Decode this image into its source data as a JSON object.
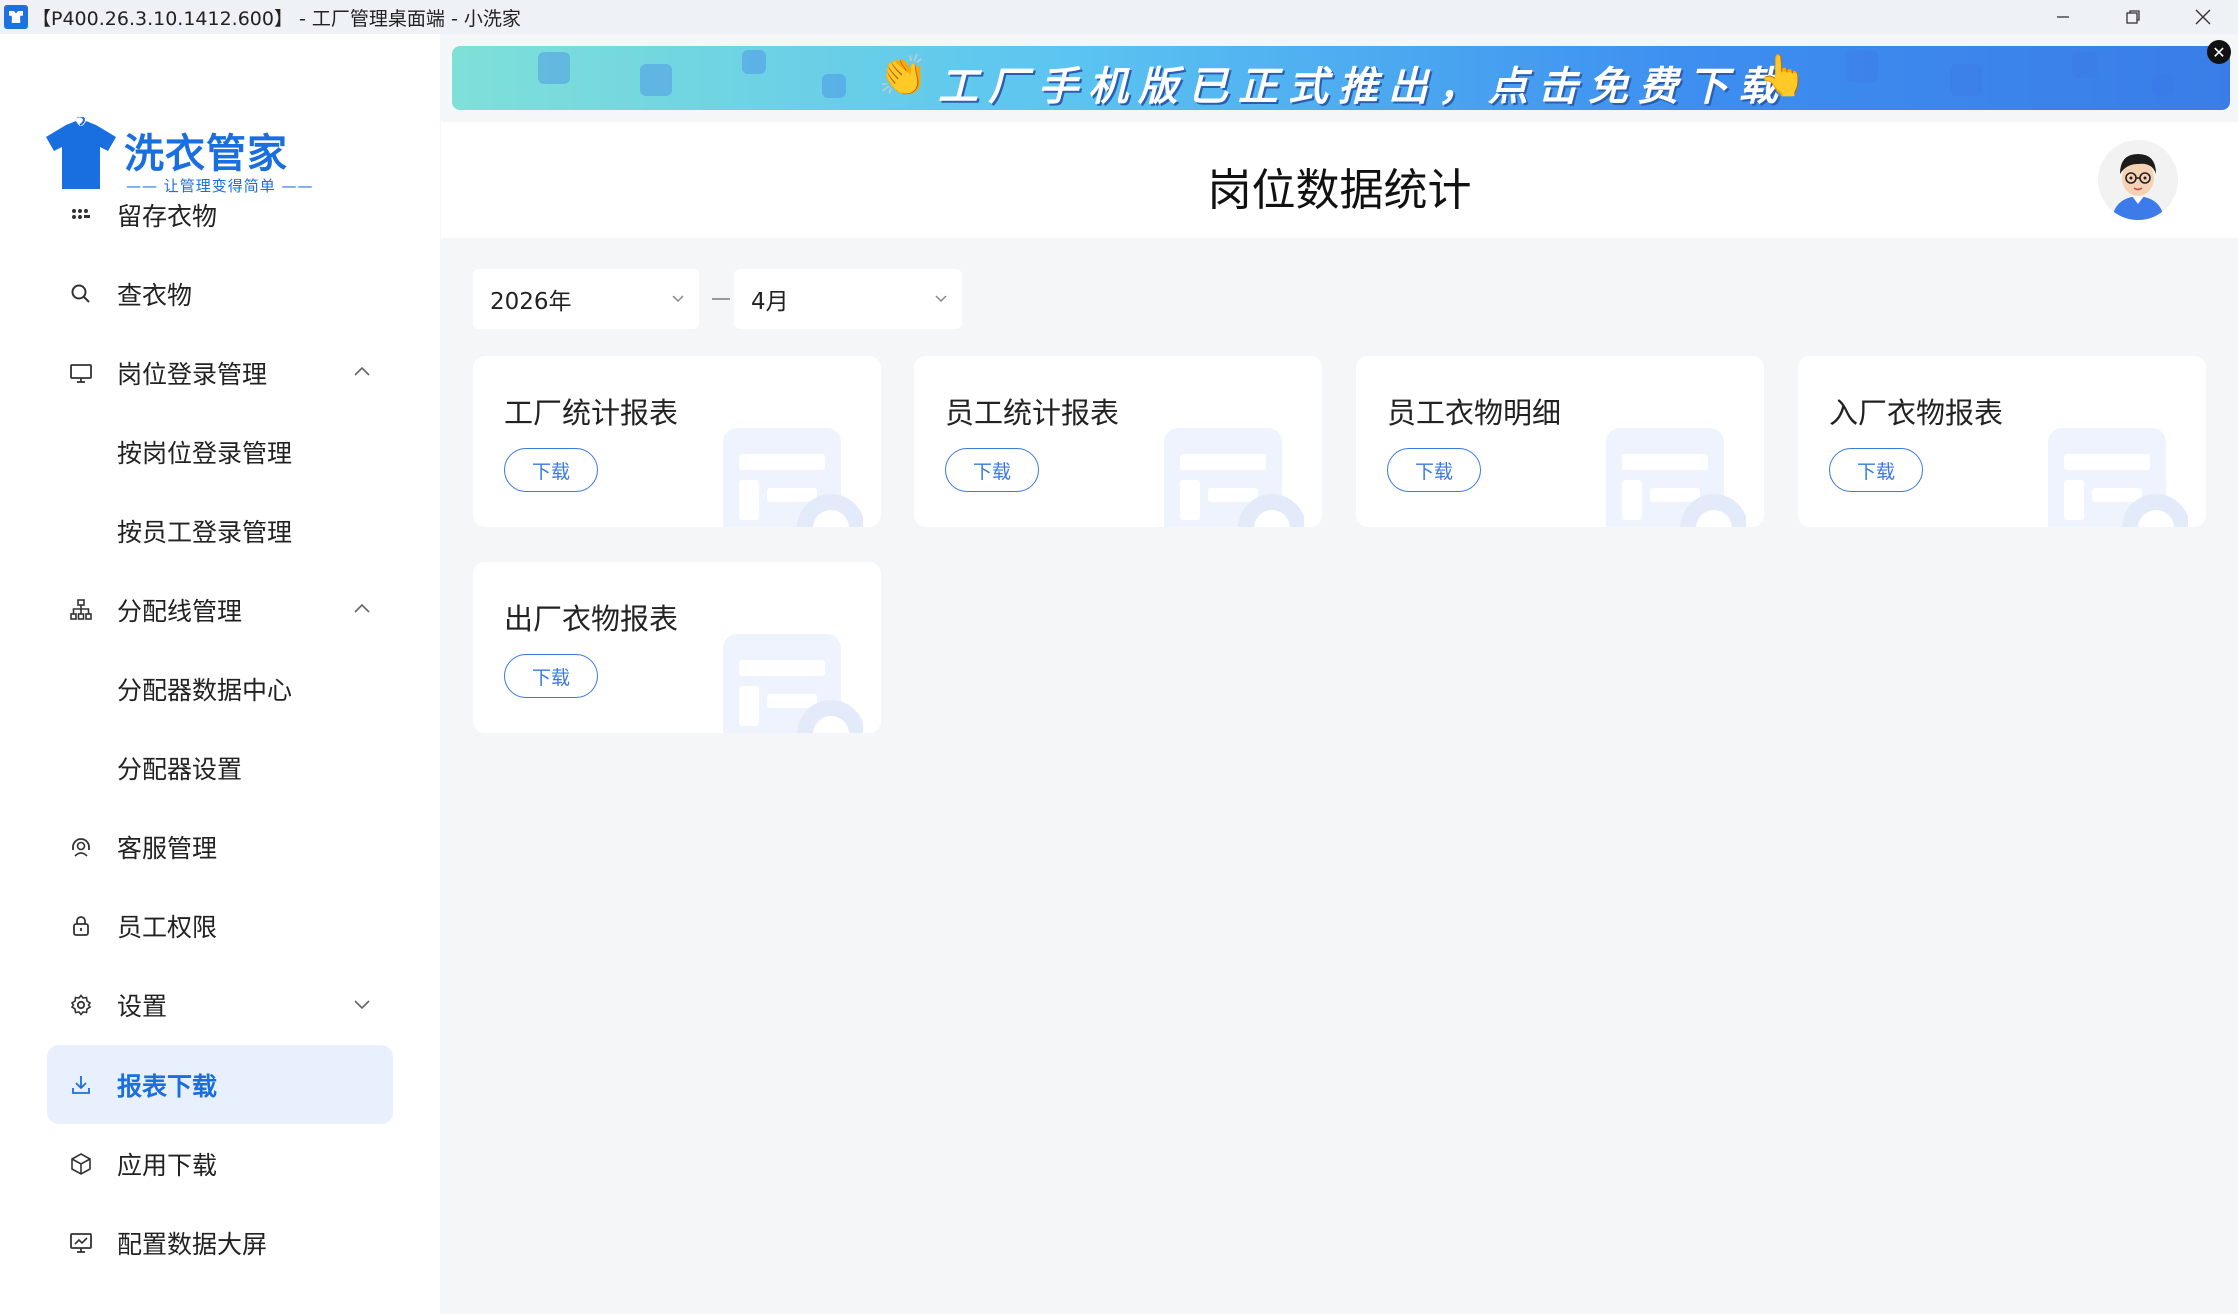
{
  "window": {
    "title": "【P400.26.3.10.1412.600】 - 工厂管理桌面端 - 小洗家",
    "minimize_icon": "minimize-icon",
    "maximize_icon": "restore-icon",
    "close_icon": "close-icon"
  },
  "logo": {
    "brand": "洗衣管家",
    "slogan": "—— 让管理变得简单 ——"
  },
  "sidebar": {
    "items": [
      {
        "label": "留存衣物",
        "icon": "grid-dots-icon"
      },
      {
        "label": "查衣物",
        "icon": "search-icon"
      },
      {
        "label": "岗位登录管理",
        "icon": "monitor-icon",
        "expanded": true
      },
      {
        "label": "按岗位登录管理"
      },
      {
        "label": "按员工登录管理"
      },
      {
        "label": "分配线管理",
        "icon": "org-chart-icon",
        "expanded": true
      },
      {
        "label": "分配器数据中心"
      },
      {
        "label": "分配器设置"
      },
      {
        "label": "客服管理",
        "icon": "headset-icon"
      },
      {
        "label": "员工权限",
        "icon": "lock-icon"
      },
      {
        "label": "设置",
        "icon": "gear-icon",
        "expanded": false
      },
      {
        "label": "报表下载",
        "icon": "download-icon",
        "active": true
      },
      {
        "label": "应用下载",
        "icon": "box-icon"
      },
      {
        "label": "配置数据大屏",
        "icon": "screen-chart-icon"
      }
    ]
  },
  "banner": {
    "text": "工厂手机版已正式推出，点击免费下载",
    "close_icon": "close-icon"
  },
  "header": {
    "title": "岗位数据统计"
  },
  "filters": {
    "year": "2026年",
    "month": "4月"
  },
  "cards": [
    {
      "title": "工厂统计报表",
      "button": "下载"
    },
    {
      "title": "员工统计报表",
      "button": "下载"
    },
    {
      "title": "员工衣物明细",
      "button": "下载"
    },
    {
      "title": "入厂衣物报表",
      "button": "下载"
    },
    {
      "title": "出厂衣物报表",
      "button": "下载"
    }
  ],
  "colors": {
    "accent": "#1a6fe0",
    "active_bg": "#e8f0fd",
    "page_bg": "#f5f6f8"
  }
}
